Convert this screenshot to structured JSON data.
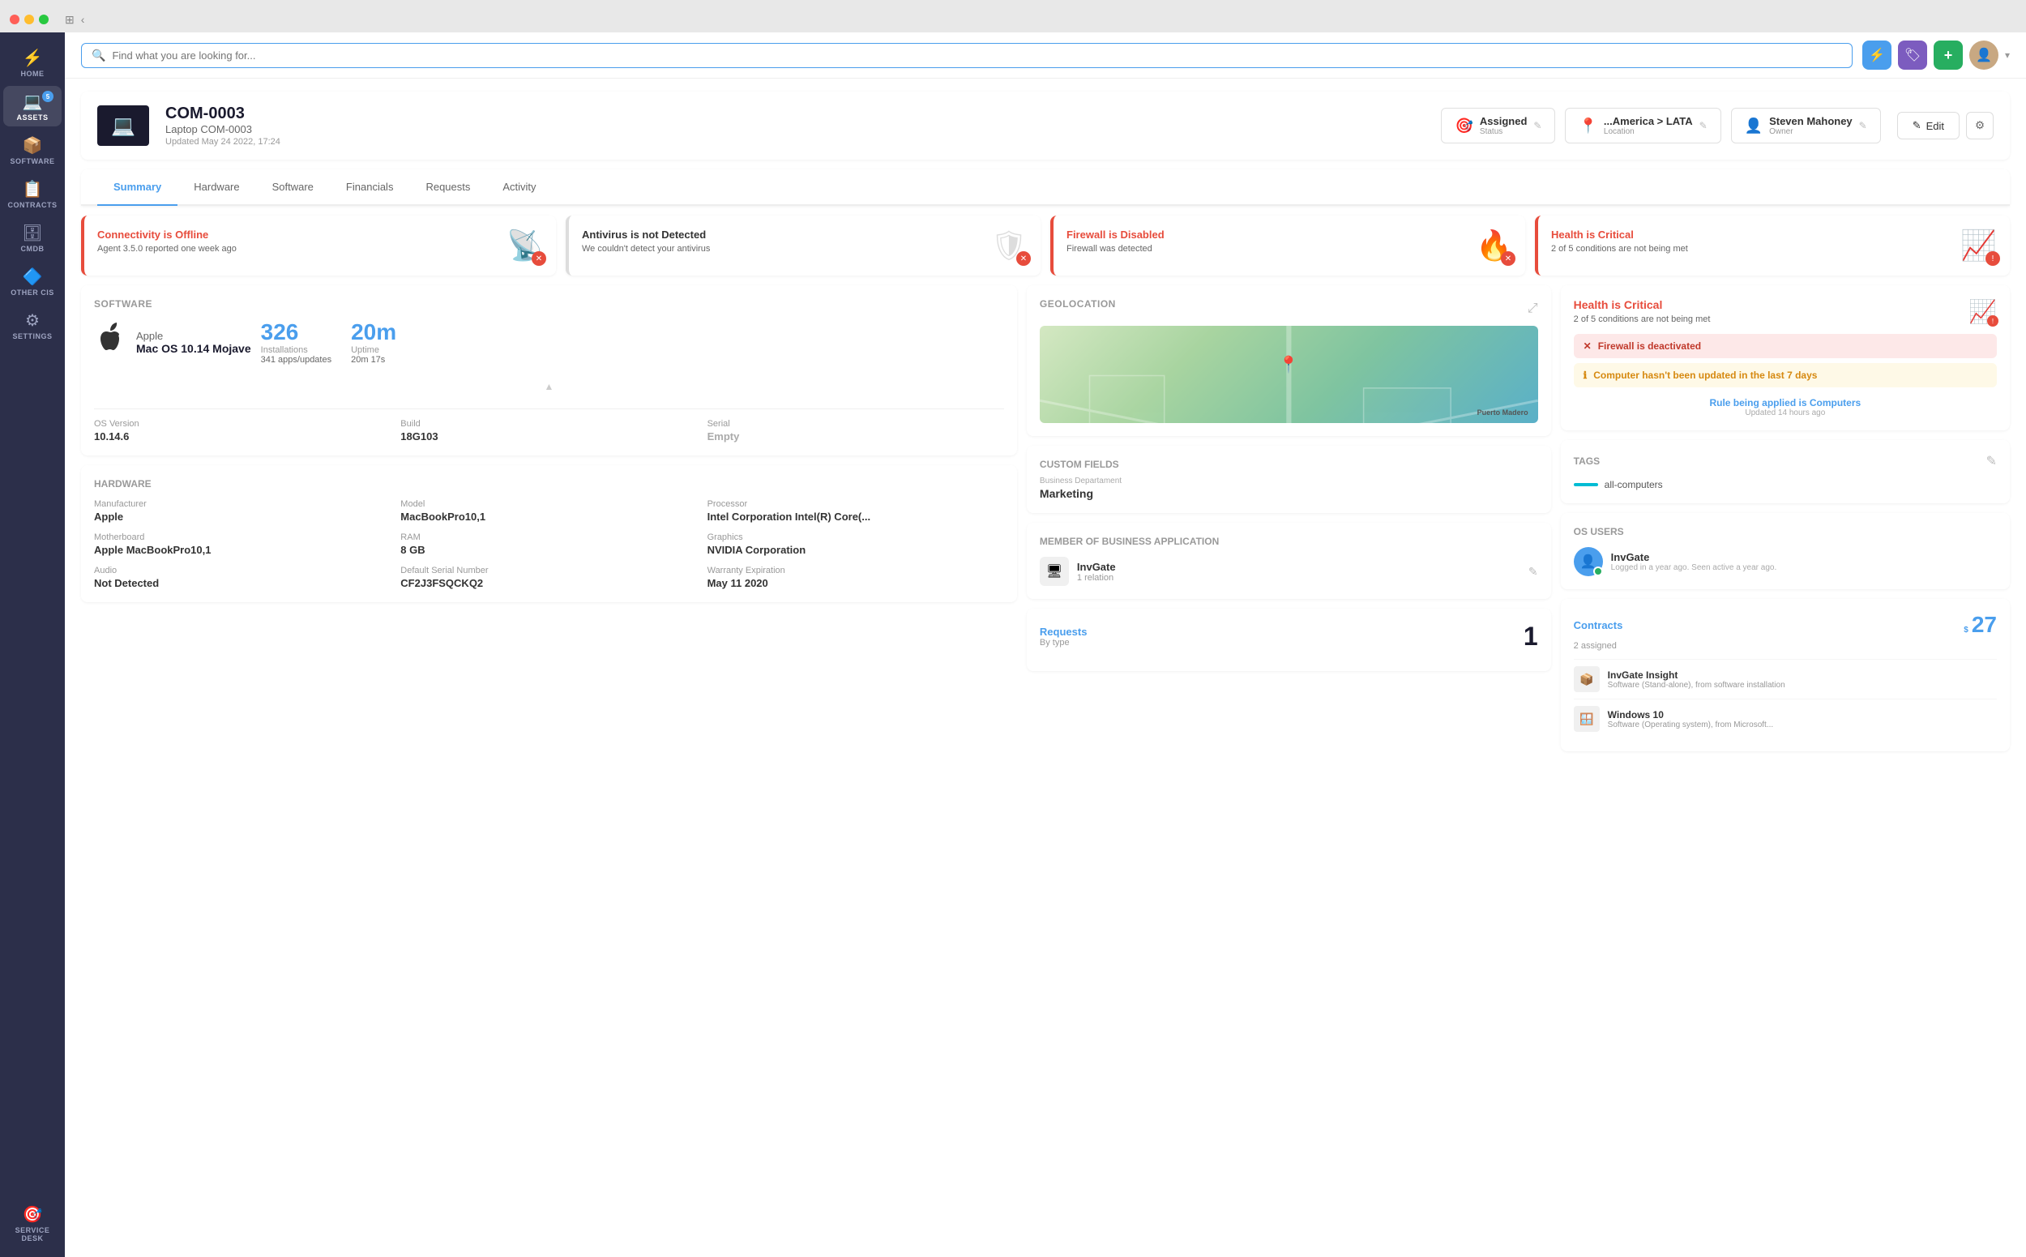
{
  "browser": {
    "traffic_lights": [
      "red",
      "yellow",
      "green"
    ]
  },
  "sidebar": {
    "items": [
      {
        "id": "home",
        "label": "HOME",
        "icon": "⚡",
        "badge": null,
        "active": false
      },
      {
        "id": "assets",
        "label": "ASSETS",
        "icon": "💻",
        "badge": "5",
        "active": false
      },
      {
        "id": "software",
        "label": "SOFTWARE",
        "icon": "📦",
        "badge": null,
        "active": false
      },
      {
        "id": "contracts",
        "label": "CONTRACTS",
        "icon": "📋",
        "badge": null,
        "active": false
      },
      {
        "id": "cmdb",
        "label": "CMDB",
        "icon": "🗄",
        "badge": null,
        "active": false
      },
      {
        "id": "other-cis",
        "label": "OTHER CIs",
        "icon": "🔷",
        "badge": null,
        "active": false
      },
      {
        "id": "settings",
        "label": "SETTINGS",
        "icon": "⚙",
        "badge": null,
        "active": false
      },
      {
        "id": "service-desk",
        "label": "SERVICE DESK",
        "icon": "🎯",
        "badge": null,
        "active": false
      }
    ]
  },
  "topbar": {
    "search_placeholder": "Find what you are looking for...",
    "btn_tag_icon": "🏷",
    "btn_plus_icon": "+"
  },
  "asset": {
    "id": "COM-0003",
    "subtitle": "Laptop COM-0003",
    "updated": "Updated May 24 2022, 17:24",
    "status_label": "Status",
    "status_value": "Assigned",
    "location_label": "Location",
    "location_value": "...America > LATA",
    "owner_label": "Owner",
    "owner_value": "Steven Mahoney",
    "btn_edit": "Edit"
  },
  "tabs": {
    "items": [
      "Summary",
      "Hardware",
      "Software",
      "Financials",
      "Requests",
      "Activity"
    ],
    "active": "Summary"
  },
  "alerts": [
    {
      "id": "connectivity",
      "title": "Connectivity is Offline",
      "desc": "Agent 3.5.0 reported one week ago",
      "severity": "danger",
      "icon": "📡"
    },
    {
      "id": "antivirus",
      "title": "Antivirus is not Detected",
      "desc": "We couldn't detect your antivirus",
      "severity": "warning",
      "icon": "🛡"
    },
    {
      "id": "firewall",
      "title": "Firewall is Disabled",
      "desc": "Firewall was detected",
      "severity": "danger",
      "icon": "🔥"
    },
    {
      "id": "health",
      "title": "Health is Critical",
      "desc": "2 of 5 conditions are not being met",
      "severity": "danger",
      "icon": "📈"
    }
  ],
  "software_section": {
    "title": "Software",
    "brand": "Apple",
    "os": "Mac OS 10.14 Mojave",
    "installations_count": "326",
    "installations_label": "Installations",
    "installations_sub": "341 apps/updates",
    "uptime_count": "20m",
    "uptime_label": "Uptime",
    "uptime_sub": "20m 17s",
    "os_version_label": "OS Version",
    "os_version": "10.14.6",
    "build_label": "Build",
    "build": "18G103",
    "serial_label": "Serial",
    "serial": "Empty"
  },
  "hardware_section": {
    "title": "Hardware",
    "manufacturer_label": "Manufacturer",
    "manufacturer": "Apple",
    "model_label": "Model",
    "model": "MacBookPro10,1",
    "processor_label": "Processor",
    "processor": "Intel Corporation Intel(R) Core(...",
    "motherboard_label": "Motherboard",
    "motherboard": "Apple MacBookPro10,1",
    "ram_label": "RAM",
    "ram": "8 GB",
    "graphics_label": "Graphics",
    "graphics": "NVIDIA Corporation",
    "audio_label": "Audio",
    "audio": "Not Detected",
    "default_serial_label": "Default Serial Number",
    "default_serial": "CF2J3FSQCKQ2",
    "warranty_label": "Warranty Expiration",
    "warranty": "May 11 2020"
  },
  "geolocation": {
    "title": "Geolocation"
  },
  "custom_fields": {
    "title": "Custom Fields",
    "dept_label": "Business Departament",
    "dept_value": "Marketing"
  },
  "member_app": {
    "title": "Member of Business Application",
    "name": "InvGate",
    "relations": "1 relation"
  },
  "requests": {
    "title": "Requests",
    "by_type": "By type",
    "count": "1"
  },
  "health_panel": {
    "title": "Health is Critical",
    "subtitle": "2 of 5 conditions are not being met",
    "alert1": "Firewall is deactivated",
    "alert2": "Computer hasn't been updated in the last 7 days",
    "rule_text": "Rule being applied is",
    "rule_value": "Computers",
    "updated": "Updated 14 hours ago"
  },
  "tags": {
    "title": "Tags",
    "items": [
      "all-computers"
    ]
  },
  "os_users": {
    "title": "OS Users",
    "users": [
      {
        "name": "InvGate",
        "last_login": "Logged in a year ago. Seen active a year ago."
      }
    ]
  },
  "contracts": {
    "title": "Contracts",
    "assigned": "2 assigned",
    "count": "27",
    "currency": "$",
    "items": [
      {
        "name": "InvGate Insight",
        "desc": "Software (Stand-alone), from software installation"
      },
      {
        "name": "Windows 10",
        "desc": "Software (Operating system), from Microsoft..."
      }
    ]
  }
}
